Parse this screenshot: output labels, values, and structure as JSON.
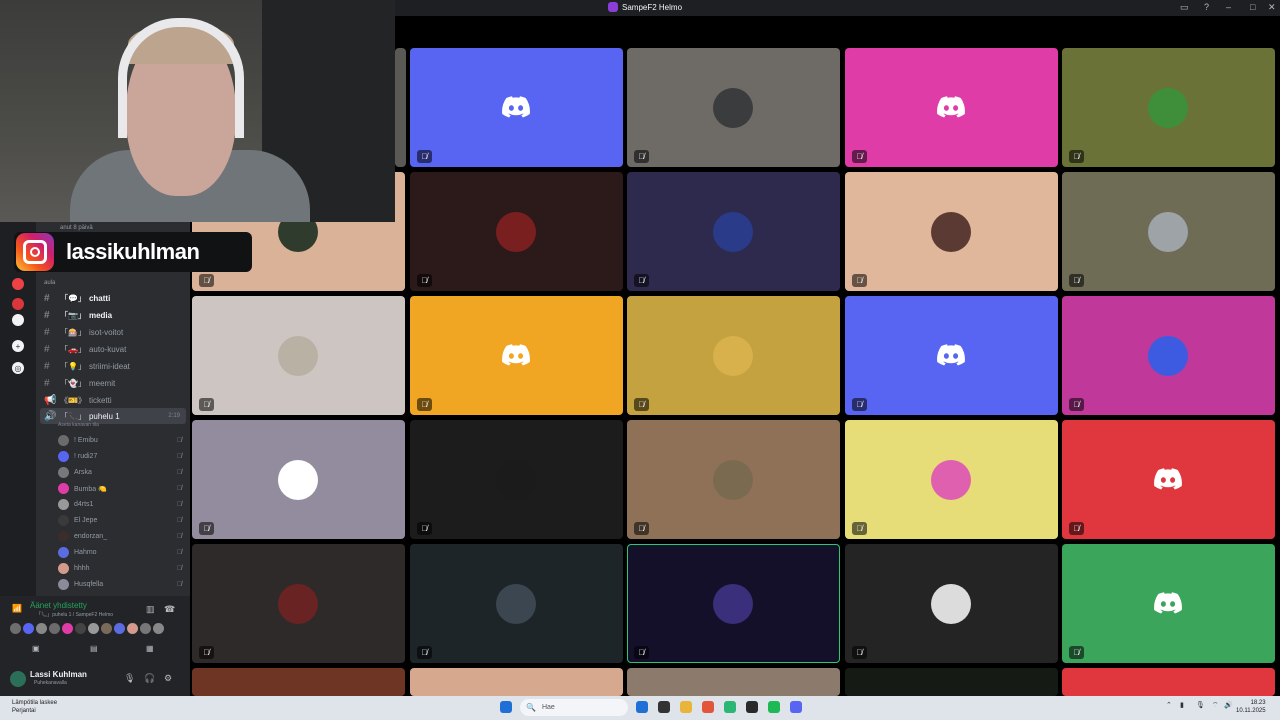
{
  "window": {
    "title": "SampeF2 Helmo",
    "controls": [
      "▭",
      "?",
      "–",
      "□",
      "✕"
    ]
  },
  "overlay": {
    "instagram_handle": "lassikuhlman"
  },
  "sidebar": {
    "server_subtitle": "anut 8 päivä",
    "category": "aula",
    "channels": [
      {
        "icon": "#",
        "bracket": "「💬」",
        "name": "chatti",
        "bold": true
      },
      {
        "icon": "#",
        "bracket": "「📷」",
        "name": "media",
        "bold": true
      },
      {
        "icon": "#",
        "bracket": "「🎰」",
        "name": "isot-voitot",
        "bold": false
      },
      {
        "icon": "#",
        "bracket": "「🚗」",
        "name": "auto-kuvat",
        "bold": false
      },
      {
        "icon": "#",
        "bracket": "「💡」",
        "name": "striimi-ideat",
        "bold": false
      },
      {
        "icon": "#",
        "bracket": "「👻」",
        "name": "meemit",
        "bold": false
      },
      {
        "icon": "📢",
        "bracket": "《🎫》",
        "name": "ticketti",
        "bold": false
      }
    ],
    "voice_channel": {
      "bracket": "「📞」",
      "name": "puhelu 1",
      "timer": "2:19",
      "status": "Aseta kanavan tila"
    },
    "voice_users": [
      {
        "name": "! Emibu",
        "color": "#6b6b6b"
      },
      {
        "name": "! rudi27",
        "color": "#5865f2"
      },
      {
        "name": "Arska",
        "color": "#77787a"
      },
      {
        "name": "Bumba 🍋",
        "color": "#e03ca7"
      },
      {
        "name": "d4rts1",
        "color": "#999999"
      },
      {
        "name": "El Jepe",
        "color": "#3a3a3a"
      },
      {
        "name": "endorzan_",
        "color": "#3a2d2a"
      },
      {
        "name": "Hahmo",
        "color": "#5b6be0"
      },
      {
        "name": "hhhh",
        "color": "#d49a8b"
      },
      {
        "name": "Husqfella",
        "color": "#8a8a9a"
      }
    ]
  },
  "voice_panel": {
    "title": "Äänet yhdistetty",
    "subtitle": "「📞」puhelu 1 / SampeF2 Helmo",
    "avatar_colors": [
      "#6e6e6e",
      "#5865f2",
      "#888",
      "#6b6b6b",
      "#e03ca7",
      "#444",
      "#999",
      "#7a6a5a",
      "#5b6be0",
      "#d49a8b",
      "#777",
      "#888"
    ]
  },
  "user_panel": {
    "name": "Lassi Kuhlman",
    "status": "Puhekanavalla"
  },
  "grid": {
    "tiles": [
      {
        "bg": "#5865f2",
        "discord": true,
        "avatar": null
      },
      {
        "bg": "#6e6b66",
        "discord": false,
        "avatar": "#3b3c3e"
      },
      {
        "bg": "#e03ca7",
        "discord": true,
        "avatar": null
      },
      {
        "bg": "#6a7237",
        "discord": false,
        "avatar": "#3f8f3a"
      },
      {
        "bg": "#d9b298",
        "discord": false,
        "avatar": "#2f3b2c"
      },
      {
        "bg": "#2b1a19",
        "discord": false,
        "avatar": "#7a1f1f"
      },
      {
        "bg": "#2d2a4e",
        "discord": false,
        "avatar": "#2a3b8a"
      },
      {
        "bg": "#e0b79a",
        "discord": false,
        "avatar": "#5b3a34"
      },
      {
        "bg": "#6e6c54",
        "discord": false,
        "avatar": "#9ea3a8"
      },
      {
        "bg": "#cdc5c2",
        "discord": false,
        "avatar": "#b9b1a4"
      },
      {
        "bg": "#f0a623",
        "discord": true,
        "avatar": null
      },
      {
        "bg": "#c3a23f",
        "discord": false,
        "avatar": "#d8b04c"
      },
      {
        "bg": "#5865f2",
        "discord": true,
        "avatar": null
      },
      {
        "bg": "#c0389a",
        "discord": false,
        "avatar": "#3d5be0"
      },
      {
        "bg": "#938c9e",
        "discord": false,
        "avatar": "#ffffff"
      },
      {
        "bg": "#1c1c1c",
        "discord": false,
        "avatar": "#1b1b1b"
      },
      {
        "bg": "#8f7158",
        "discord": false,
        "avatar": "#7a6a50"
      },
      {
        "bg": "#e6dc78",
        "discord": false,
        "avatar": "#e060b0"
      },
      {
        "bg": "#e0373f",
        "discord": true,
        "avatar": null
      },
      {
        "bg": "#2d2a29",
        "discord": false,
        "avatar": "#6a2323"
      },
      {
        "bg": "#1e2528",
        "discord": false,
        "avatar": "#3c4650"
      },
      {
        "bg": "#14102a",
        "discord": false,
        "avatar": "#3a2f7a",
        "selected": true
      },
      {
        "bg": "#242424",
        "discord": false,
        "avatar": "#dcdcdc"
      },
      {
        "bg": "#3ba55c",
        "discord": true,
        "avatar": null
      },
      {
        "bg": "#6e3524",
        "discord": false,
        "avatar": null
      },
      {
        "bg": "#d6a98f",
        "discord": false,
        "avatar": null
      },
      {
        "bg": "#8c7b6d",
        "discord": false,
        "avatar": null
      },
      {
        "bg": "#161a14",
        "discord": false,
        "avatar": null
      },
      {
        "bg": "#e0373f",
        "discord": false,
        "avatar": null
      }
    ],
    "mute_glyph": "🎙̸"
  },
  "taskbar": {
    "weather_line1": "Lämpötila laskee",
    "weather_line2": "Perjantai",
    "search_placeholder": "Hae",
    "time": "18.23",
    "date": "10.11.2025",
    "app_colors": [
      "#1f6fd6",
      "#333",
      "#e8b43a",
      "#e2553a",
      "#2bb673",
      "#2a2a2a",
      "#1db954",
      "#5865f2"
    ]
  }
}
